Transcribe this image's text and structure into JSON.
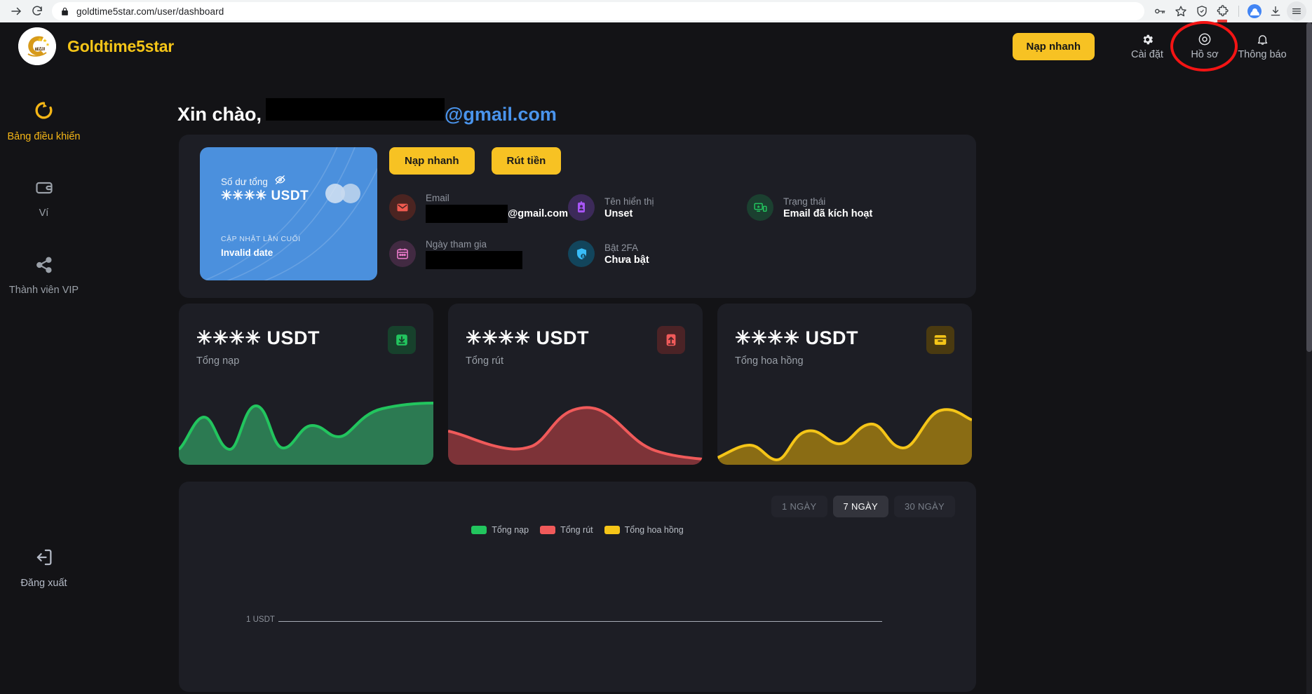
{
  "browser": {
    "url": "goldtime5star.com/user/dashboard",
    "icons": {
      "forward": "forward-arrow-icon",
      "reload": "reload-icon",
      "lock": "lock-icon",
      "password": "key-icon",
      "bookmark": "star-icon",
      "shield": "shield-icon",
      "extensions": "puzzle-piece-icon",
      "profile": "profile-avatar-icon",
      "downloads": "download-icon",
      "menu": "hamburger-menu-icon"
    }
  },
  "header": {
    "brand_name": "Goldtime5star",
    "brand_logo": "goldtime-logo-icon",
    "quick_deposit_label": "Nạp nhanh",
    "nav": [
      {
        "label": "Cài đặt",
        "icon": "gear-icon",
        "highlighted": false
      },
      {
        "label": "Hồ sơ",
        "icon": "user-circle-icon",
        "highlighted": true
      },
      {
        "label": "Thông báo",
        "icon": "bell-icon",
        "highlighted": false
      }
    ]
  },
  "sidebar": {
    "items": [
      {
        "label": "Bảng điều khiển",
        "icon": "dashboard-spinner-icon",
        "active": true
      },
      {
        "label": "Ví",
        "icon": "wallet-icon",
        "active": false
      },
      {
        "label": "Thành viên VIP",
        "icon": "share-nodes-icon",
        "active": false
      }
    ],
    "logout": {
      "label": "Đăng xuất",
      "icon": "logout-icon"
    }
  },
  "greeting": {
    "hello": "Xin chào,",
    "redacted_name": "",
    "domain": "@gmail.com"
  },
  "balance_card": {
    "label": "Số dư tổng",
    "eye_icon": "eye-off-icon",
    "amount": "✳✳✳✳ USDT",
    "updated_label": "CẬP NHẬT LẦN CUỐI",
    "updated_value": "Invalid date"
  },
  "profile_actions": {
    "deposit_label": "Nạp nhanh",
    "withdraw_label": "Rút tiền"
  },
  "profile_info": [
    {
      "label": "Email",
      "value": "@gmail.com",
      "redacted": true,
      "icon": "envelope-icon",
      "color": "#f05a4f",
      "bg": "#4b2421"
    },
    {
      "label": "Tên hiển thị",
      "value": "Unset",
      "redacted": false,
      "icon": "id-badge-icon",
      "color": "#a855f7",
      "bg": "#3c2a59"
    },
    {
      "label": "Trạng thái",
      "value": "Email đã kích hoạt",
      "redacted": false,
      "icon": "device-check-icon",
      "color": "#22c55e",
      "bg": "#1b4030"
    },
    {
      "label": "Ngày tham gia",
      "value": "",
      "redacted": true,
      "icon": "calendar-icon",
      "color": "#e879c8",
      "bg": "#422a42"
    },
    {
      "label": "Bật 2FA",
      "value": "Chưa bật",
      "redacted": false,
      "icon": "shield-user-icon",
      "color": "#38bdf8",
      "bg": "#12455c"
    }
  ],
  "stat_cards": [
    {
      "amount": "✳✳✳✳ USDT",
      "label": "Tổng nạp",
      "icon": "deposit-box-icon",
      "color": "#22c55e",
      "bg": "#17412c"
    },
    {
      "amount": "✳✳✳✳ USDT",
      "label": "Tổng rút",
      "icon": "withdraw-box-icon",
      "color": "#f05a5a",
      "bg": "#4b2326"
    },
    {
      "amount": "✳✳✳✳ USDT",
      "label": "Tổng hoa hồng",
      "icon": "commission-box-icon",
      "color": "#f5c518",
      "bg": "#4a3a10"
    }
  ],
  "chart_panel": {
    "periods": [
      {
        "label": "1 NGÀY",
        "active": false
      },
      {
        "label": "7 NGÀY",
        "active": true
      },
      {
        "label": "30 NGÀY",
        "active": false
      }
    ],
    "legend": [
      {
        "label": "Tổng nạp",
        "color": "#22c55e"
      },
      {
        "label": "Tổng rút",
        "color": "#f05a5a"
      },
      {
        "label": "Tổng hoa hồng",
        "color": "#f5c518"
      }
    ],
    "axis_tick": "1 USDT"
  },
  "chart_data": [
    {
      "type": "area",
      "name": "Tổng nạp sparkline",
      "title": "Tổng nạp",
      "color": "#22c55e",
      "x": [
        0,
        1,
        2,
        3,
        4,
        5,
        6,
        7,
        8,
        9,
        10
      ],
      "values": [
        0.18,
        0.52,
        0.12,
        0.78,
        0.55,
        0.14,
        0.3,
        0.46,
        0.34,
        0.6,
        0.78
      ],
      "ylim": [
        0,
        1
      ],
      "grid": false,
      "legend": "none"
    },
    {
      "type": "area",
      "name": "Tổng rút sparkline",
      "title": "Tổng rút",
      "color": "#f05a5a",
      "x": [
        0,
        1,
        2,
        3,
        4,
        5,
        6,
        7,
        8,
        9,
        10
      ],
      "values": [
        0.3,
        0.22,
        0.14,
        0.1,
        0.22,
        0.52,
        0.7,
        0.66,
        0.46,
        0.22,
        0.1
      ],
      "ylim": [
        0,
        1
      ],
      "grid": false,
      "legend": "none"
    },
    {
      "type": "area",
      "name": "Tổng hoa hồng sparkline",
      "title": "Tổng hoa hồng",
      "color": "#d4a814",
      "x": [
        0,
        1,
        2,
        3,
        4,
        5,
        6,
        7,
        8,
        9,
        10
      ],
      "values": [
        0.06,
        0.22,
        0.12,
        0.04,
        0.34,
        0.42,
        0.26,
        0.52,
        0.42,
        0.12,
        0.82
      ],
      "ylim": [
        0,
        1
      ],
      "grid": false,
      "legend": "none"
    },
    {
      "type": "line",
      "name": "Tổng quan 7 ngày",
      "title": "",
      "series": [
        {
          "name": "Tổng nạp",
          "color": "#22c55e",
          "values": [
            0,
            0,
            0,
            0,
            0,
            0,
            0
          ]
        },
        {
          "name": "Tổng rút",
          "color": "#f05a5a",
          "values": [
            0,
            0,
            0,
            0,
            0,
            0,
            0
          ]
        },
        {
          "name": "Tổng hoa hồng",
          "color": "#f5c518",
          "values": [
            0,
            0,
            0,
            0,
            0,
            0,
            0
          ]
        }
      ],
      "yticks": [
        "1 USDT"
      ],
      "ylim": [
        0,
        1
      ],
      "grid": true,
      "legend": "top-center"
    }
  ]
}
